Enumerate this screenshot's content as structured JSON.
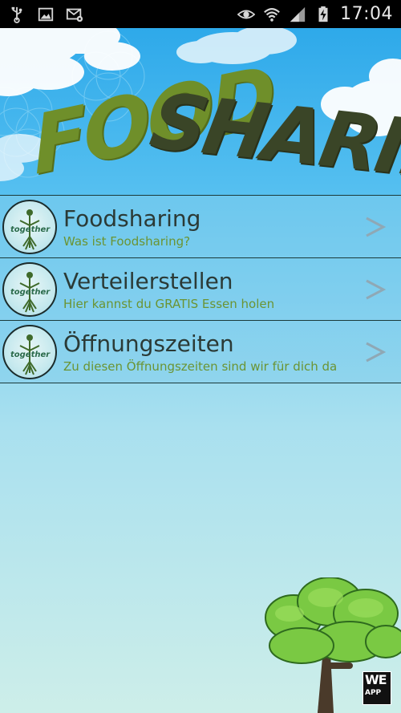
{
  "status_bar": {
    "time": "17:04",
    "icons": [
      "usb-icon",
      "image-icon",
      "mail-settings-icon",
      "eye-icon",
      "wifi-icon",
      "signal-icon",
      "battery-charging-icon"
    ]
  },
  "header": {
    "logo_part1": "FOOD",
    "logo_part2": "SHARING"
  },
  "menu": {
    "items": [
      {
        "title": "Foodsharing",
        "subtitle": "Was ist Foodsharing?",
        "icon": "together-logo-icon"
      },
      {
        "title": "Verteilerstellen",
        "subtitle": "Hier kannst du GRATIS Essen holen",
        "icon": "together-logo-icon"
      },
      {
        "title": "Öffnungszeiten",
        "subtitle": "Zu diesen Öffnungszeiten sind wir für dich da",
        "icon": "together-logo-icon"
      }
    ],
    "avatar_text": "together"
  },
  "footer": {
    "badge_line1": "WE",
    "badge_line2": "APP"
  },
  "colors": {
    "sky_top": "#39b6ee",
    "sky_bottom": "#cdeee9",
    "title_text": "#2b3a36",
    "subtitle_text": "#6b9433",
    "logo_food": "#6f8f2a",
    "logo_sharing": "#3a4527"
  }
}
